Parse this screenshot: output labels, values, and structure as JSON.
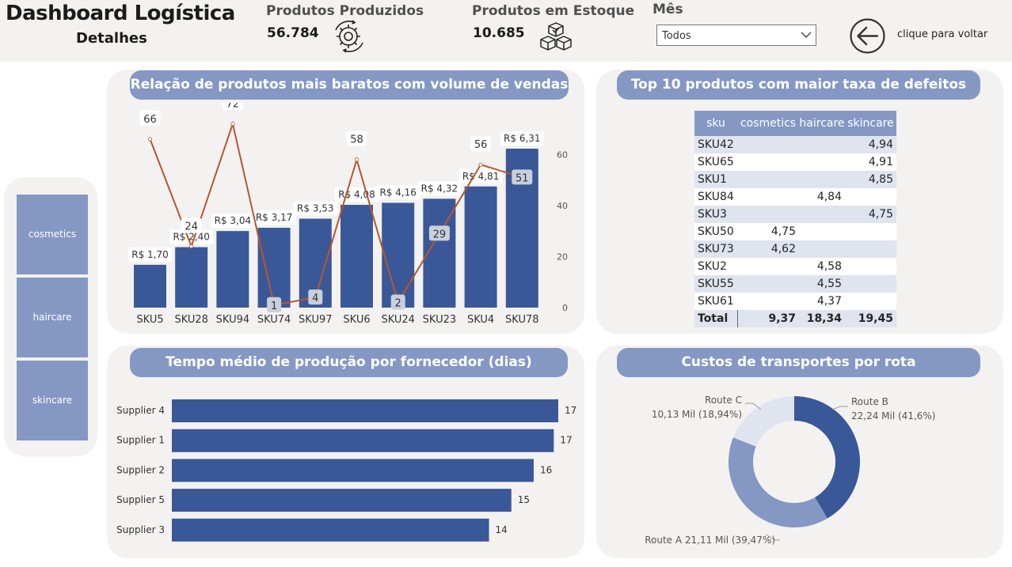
{
  "header": {
    "title": "Dashboard Logística",
    "subtitle": "Detalhes",
    "kpi_produced": {
      "label": "Produtos Produzidos",
      "value": "56.784",
      "icon": "gears-icon"
    },
    "kpi_stock": {
      "label": "Produtos em Estoque",
      "value": "10.685",
      "icon": "boxes-icon"
    },
    "month_filter": {
      "label": "Mês",
      "selected": "Todos"
    },
    "back": {
      "label": "clique para voltar",
      "icon": "arrow-left-circle-icon"
    }
  },
  "slicer": {
    "items": [
      "cosmetics",
      "haircare",
      "skincare"
    ]
  },
  "panels": {
    "price_sales": "Relação de produtos mais baratos com volume de vendas",
    "defects": "Top 10 produtos com maior taxa de defeitos",
    "production_time": "Tempo médio de produção por fornecedor (dias)",
    "transport": "Custos de transportes por rota"
  },
  "defects_table": {
    "columns": [
      "sku",
      "cosmetics",
      "haircare",
      "skincare"
    ],
    "rows": [
      [
        "SKU42",
        "",
        "",
        "4,94"
      ],
      [
        "SKU65",
        "",
        "",
        "4,91"
      ],
      [
        "SKU1",
        "",
        "",
        "4,85"
      ],
      [
        "SKU84",
        "",
        "4,84",
        ""
      ],
      [
        "SKU3",
        "",
        "",
        "4,75"
      ],
      [
        "SKU50",
        "4,75",
        "",
        ""
      ],
      [
        "SKU73",
        "4,62",
        "",
        ""
      ],
      [
        "SKU2",
        "",
        "4,58",
        ""
      ],
      [
        "SKU55",
        "",
        "4,55",
        ""
      ],
      [
        "SKU61",
        "",
        "4,37",
        ""
      ]
    ],
    "total": [
      "Total",
      "9,37",
      "18,34",
      "19,45"
    ]
  },
  "chart_data": [
    {
      "type": "bar",
      "chart_kind": "bar+line combo",
      "categories": [
        "SKU5",
        "SKU28",
        "SKU94",
        "SKU74",
        "SKU97",
        "SKU6",
        "SKU24",
        "SKU23",
        "SKU4",
        "SKU78"
      ],
      "series": [
        {
          "values": [
            1.7,
            2.4,
            3.04,
            3.17,
            3.53,
            4.08,
            4.16,
            4.32,
            4.81,
            6.31
          ],
          "labels": [
            "R$ 1,70",
            "R$ 2,40",
            "R$ 3,04",
            "R$ 3,17",
            "R$ 3,53",
            "R$ 4,08",
            "R$ 4,16",
            "R$ 4,32",
            "R$ 4,81",
            "R$ 6,31"
          ],
          "type": "bar",
          "color": "#3a5897"
        },
        {
          "values": [
            66,
            24,
            72,
            1,
            4,
            58,
            2,
            29,
            56,
            51
          ],
          "type": "line",
          "color": "#b8552f",
          "axis": "right"
        }
      ],
      "y2_ticks": [
        0,
        20,
        40,
        60
      ],
      "y2lim": [
        0,
        70
      ],
      "ylim": [
        0,
        7
      ]
    },
    {
      "type": "bar",
      "orientation": "horizontal",
      "categories": [
        "Supplier 4",
        "Supplier 1",
        "Supplier 2",
        "Supplier 5",
        "Supplier 3"
      ],
      "values": [
        17.3,
        17.1,
        16.2,
        15.2,
        14.2
      ],
      "value_labels": [
        "17",
        "17",
        "16",
        "15",
        "14"
      ],
      "color": "#3a5897"
    },
    {
      "type": "pie",
      "variant": "donut",
      "slices": [
        {
          "name": "Route B",
          "value": 22.24,
          "label": "22,24 Mil (41,6%)",
          "percent": 41.6,
          "color": "#3a5897"
        },
        {
          "name": "Route A",
          "value": 21.11,
          "label": "21,11 Mil (39,47%)",
          "percent": 39.47,
          "color": "#8598c3"
        },
        {
          "name": "Route C",
          "value": 10.13,
          "label": "10,13 Mil (18,94%)",
          "percent": 18.94,
          "color": "#dfe4ef"
        }
      ]
    }
  ]
}
